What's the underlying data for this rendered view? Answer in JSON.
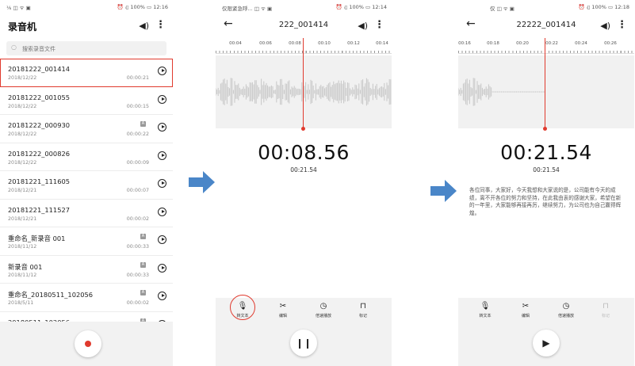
{
  "colors": {
    "accent": "#e03a2e",
    "arrow": "#4a86c8",
    "wave": "#c8c8c8",
    "panel": "#f2f2f2"
  },
  "screen1": {
    "status_left": "⅙  ◫ ᯤ ▣",
    "status_right": "⏰ ᵢ▯ 100% ▭ 12:16",
    "title": "录音机",
    "search_placeholder": "搜索录音文件",
    "recordings": [
      {
        "name": "20181222_001414",
        "date": "2018/12/22",
        "duration": "00:00:21",
        "badge": "",
        "selected": true
      },
      {
        "name": "20181222_001055",
        "date": "2018/12/22",
        "duration": "00:00:15",
        "badge": ""
      },
      {
        "name": "20181222_000930",
        "date": "2018/12/22",
        "duration": "00:00:22",
        "badge": "A"
      },
      {
        "name": "20181222_000826",
        "date": "2018/12/22",
        "duration": "00:00:09",
        "badge": ""
      },
      {
        "name": "20181221_111605",
        "date": "2018/12/21",
        "duration": "00:00:07",
        "badge": ""
      },
      {
        "name": "20181221_111527",
        "date": "2018/12/21",
        "duration": "00:00:02",
        "badge": ""
      },
      {
        "name": "重命名_新录音 001",
        "date": "2018/11/12",
        "duration": "00:00:33",
        "badge": "A"
      },
      {
        "name": "新录音 001",
        "date": "2018/11/12",
        "duration": "00:00:33",
        "badge": "A"
      },
      {
        "name": "重命名_20180511_102056",
        "date": "2018/5/11",
        "duration": "00:00:02",
        "badge": "A"
      },
      {
        "name": "20180511_102056",
        "date": "",
        "duration": "",
        "badge": "A"
      }
    ]
  },
  "screen2": {
    "status_left": "仅限紧急呼... ◫ ᯤ ▣",
    "status_right": "⏰ ᵢ▯ 100% ▭ 12:14",
    "title": "222_001414",
    "ticks": [
      "00:04",
      "00:06",
      "00:08",
      "00:10",
      "00:12",
      "00:14"
    ],
    "current_time": "00:08.56",
    "total_time": "00:21.54",
    "tools": [
      {
        "icon": "🎙",
        "label": "转文本"
      },
      {
        "icon": "✂",
        "label": "编辑"
      },
      {
        "icon": "◷",
        "label": "倍速播放"
      },
      {
        "icon": "⊓",
        "label": "标记"
      }
    ],
    "control": "❙❙"
  },
  "screen3": {
    "status_left": "仅 ◫ ᯤ ▣",
    "status_right": "⏰ ᵢ▯ 100% ▭ 12:18",
    "title": "22222_001414",
    "ticks": [
      "00:16",
      "00:18",
      "00:20",
      "00:22",
      "00:24",
      "00:26"
    ],
    "current_time": "00:21.54",
    "total_time": "00:21.54",
    "transcript": "各位同事，大家好，今天我想和大家说的是，公司能有今天的成绩，离不开各位的努力和坚持，在此我由衷的感谢大家，希望在新的一年里，大家能够再接再厉，继续努力，为公司也为自己赢得辉煌。",
    "tools": [
      {
        "icon": "🎙",
        "label": "转文本"
      },
      {
        "icon": "✂",
        "label": "编辑"
      },
      {
        "icon": "◷",
        "label": "倍速播放"
      },
      {
        "icon": "⊓",
        "label": "标记"
      }
    ],
    "control": "▶"
  }
}
